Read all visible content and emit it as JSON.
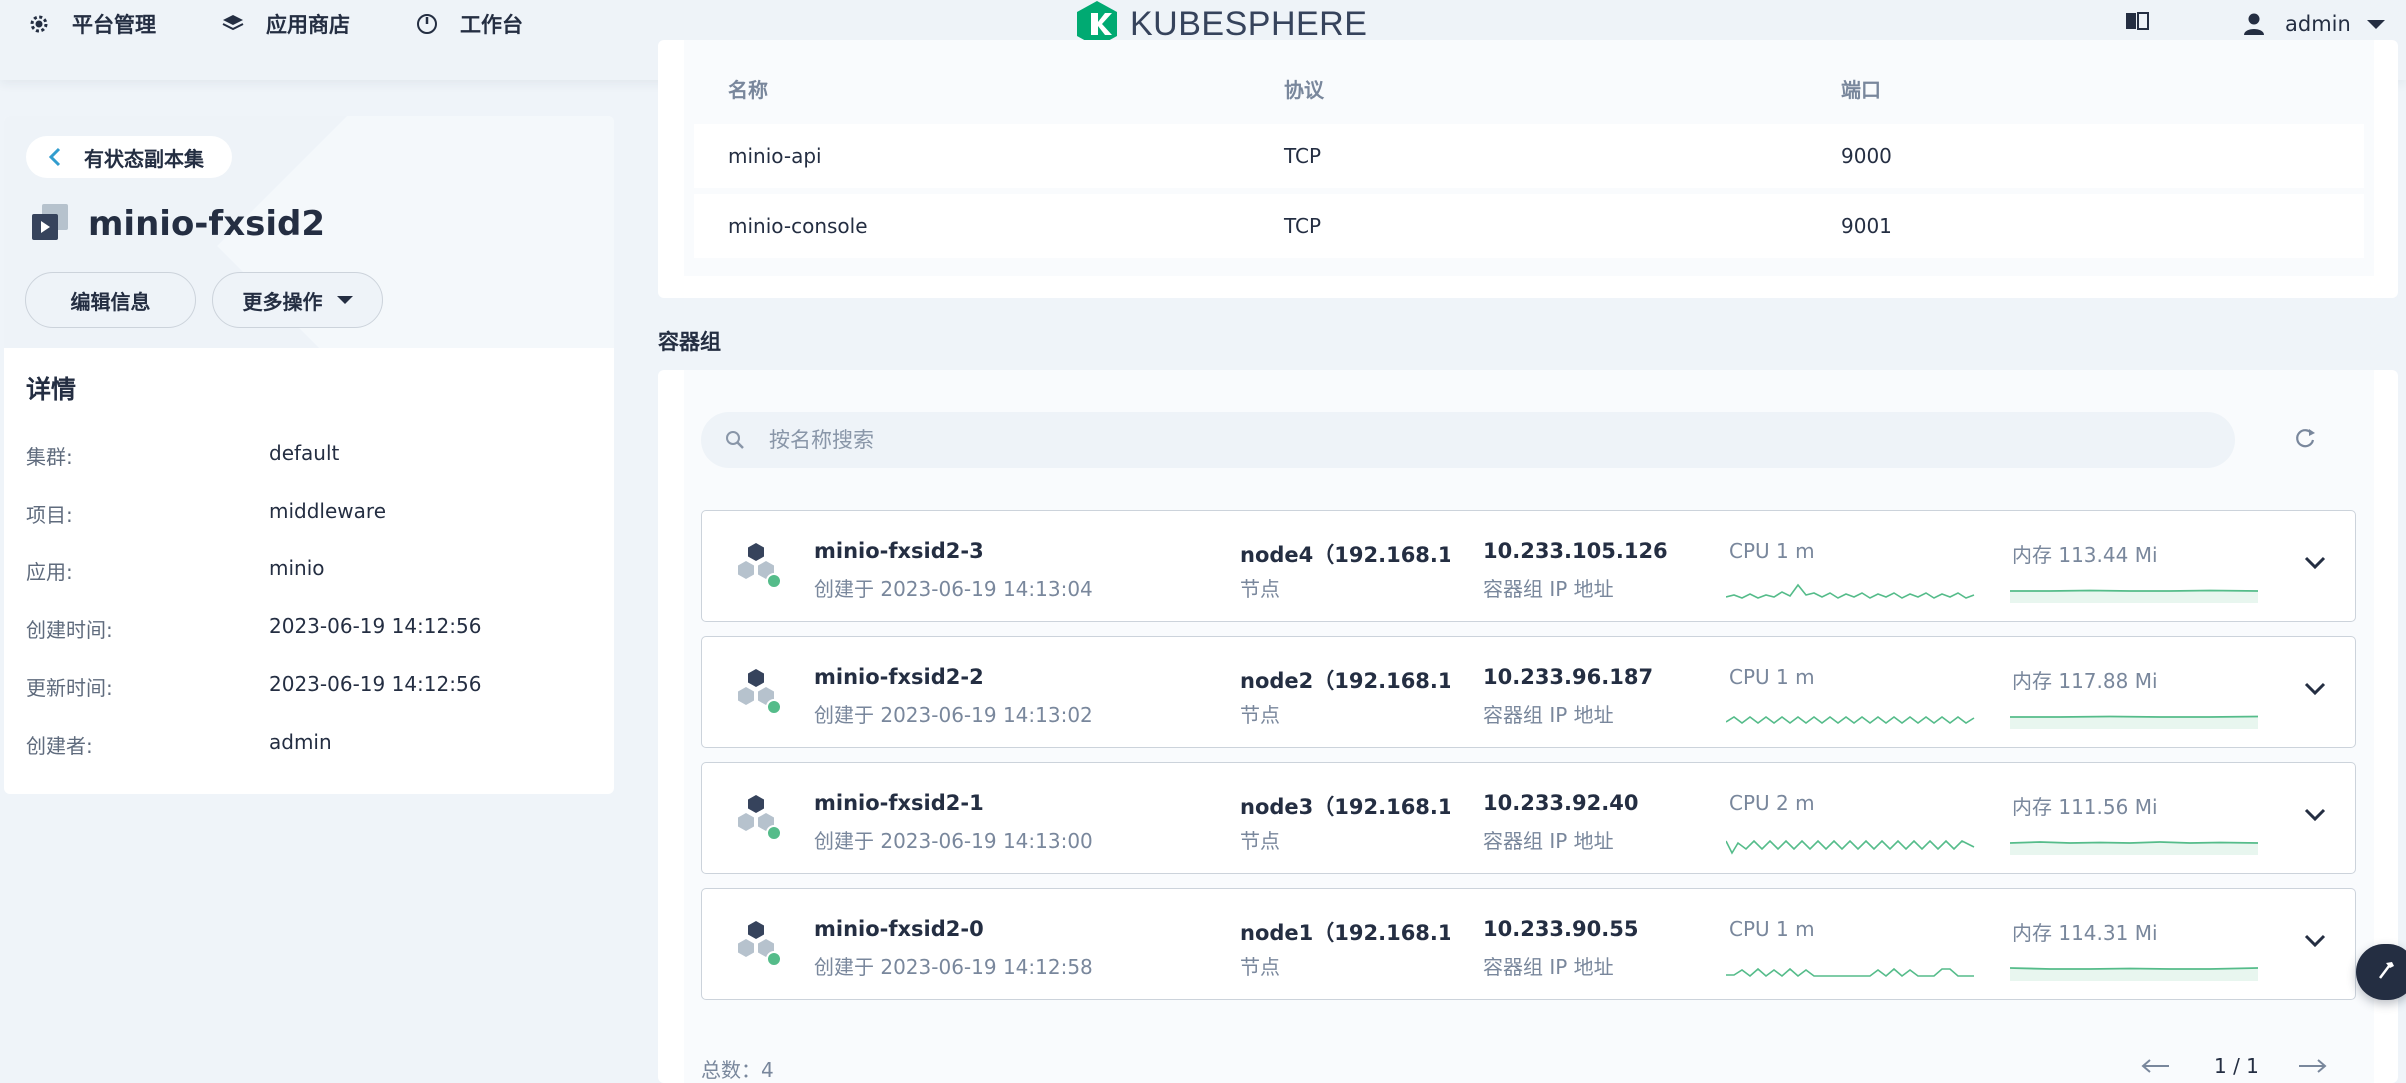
{
  "topnav": {
    "platform": "平台管理",
    "appstore": "应用商店",
    "workbench": "工作台",
    "logo": "KUBESPHERE",
    "user": "admin"
  },
  "left": {
    "back_label": "有状态副本集",
    "resource_name": "minio-fxsid2",
    "edit_label": "编辑信息",
    "more_label": "更多操作",
    "details_title": "详情",
    "details": [
      {
        "label": "集群:",
        "value": "default"
      },
      {
        "label": "项目:",
        "value": "middleware"
      },
      {
        "label": "应用:",
        "value": "minio"
      },
      {
        "label": "创建时间:",
        "value": "2023-06-19 14:12:56"
      },
      {
        "label": "更新时间:",
        "value": "2023-06-19 14:12:56"
      },
      {
        "label": "创建者:",
        "value": "admin"
      }
    ]
  },
  "ports": {
    "headers": [
      "名称",
      "协议",
      "端口"
    ],
    "rows": [
      {
        "name": "minio-api",
        "protocol": "TCP",
        "port": "9000"
      },
      {
        "name": "minio-console",
        "protocol": "TCP",
        "port": "9001"
      }
    ]
  },
  "pods": {
    "section_title": "容器组",
    "search_placeholder": "按名称搜索",
    "node_label": "节点",
    "ip_label": "容器组 IP 地址",
    "status_color": "#55bc8a",
    "items": [
      {
        "name": "minio-fxsid2-3",
        "created": "创建于 2023-06-19 14:13:04",
        "node": "node4（192.168.1....",
        "ip": "10.233.105.126",
        "cpu": "CPU 1 m",
        "mem": "内存 113.44 Mi"
      },
      {
        "name": "minio-fxsid2-2",
        "created": "创建于 2023-06-19 14:13:02",
        "node": "node2（192.168.1....",
        "ip": "10.233.96.187",
        "cpu": "CPU 1 m",
        "mem": "内存 117.88 Mi"
      },
      {
        "name": "minio-fxsid2-1",
        "created": "创建于 2023-06-19 14:13:00",
        "node": "node3（192.168.1....",
        "ip": "10.233.92.40",
        "cpu": "CPU 2 m",
        "mem": "内存 111.56 Mi"
      },
      {
        "name": "minio-fxsid2-0",
        "created": "创建于 2023-06-19 14:12:58",
        "node": "node1（192.168.1....",
        "ip": "10.233.90.55",
        "cpu": "CPU 1 m",
        "mem": "内存 114.31 Mi"
      }
    ],
    "total": "总数：4",
    "page": "1 / 1"
  },
  "icons": {
    "platform": "gear-icon",
    "appstore": "layers-icon",
    "workbench": "dashboard-icon",
    "docs": "book-icon",
    "user": "user-icon",
    "back": "chevron-left-icon",
    "search": "search-icon",
    "refresh": "refresh-icon",
    "expand": "chevron-down-icon",
    "tool": "hammer-icon"
  },
  "colors": {
    "accent": "#00aa72",
    "sparkline": "#55bc8a",
    "text": "#242e42"
  }
}
